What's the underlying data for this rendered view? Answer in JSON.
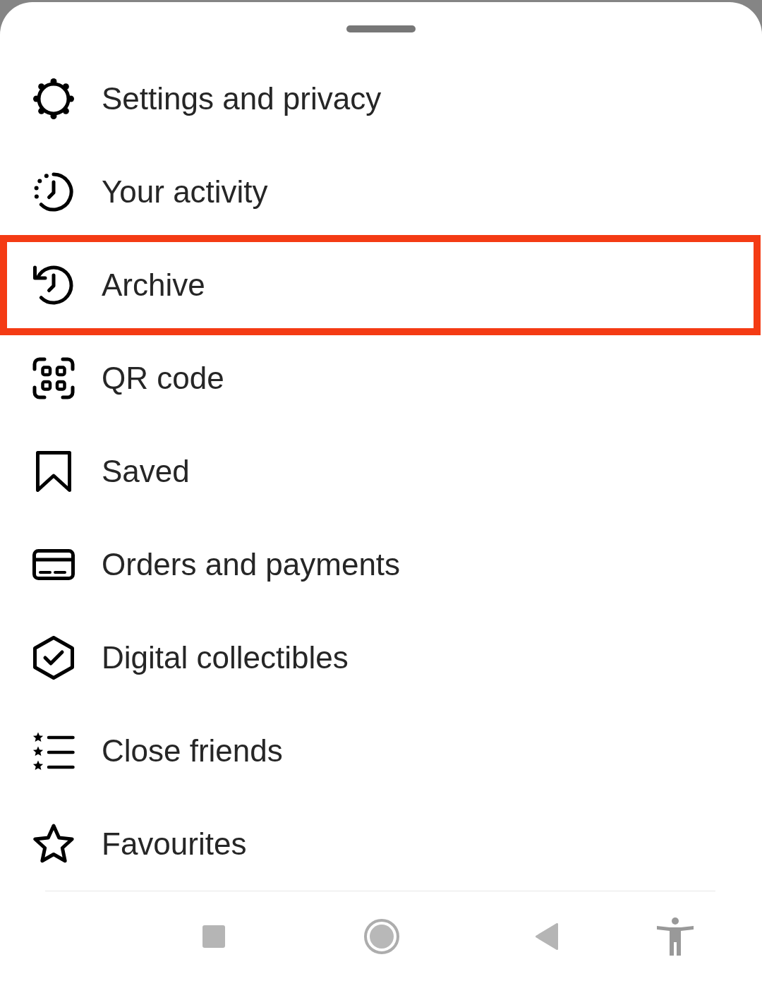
{
  "sheet": {
    "items": [
      {
        "label": "Settings and privacy",
        "highlighted": false
      },
      {
        "label": "Your activity",
        "highlighted": false
      },
      {
        "label": "Archive",
        "highlighted": true
      },
      {
        "label": "QR code",
        "highlighted": false
      },
      {
        "label": "Saved",
        "highlighted": false
      },
      {
        "label": "Orders and payments",
        "highlighted": false
      },
      {
        "label": "Digital collectibles",
        "highlighted": false
      },
      {
        "label": "Close friends",
        "highlighted": false
      },
      {
        "label": "Favourites",
        "highlighted": false
      }
    ]
  }
}
